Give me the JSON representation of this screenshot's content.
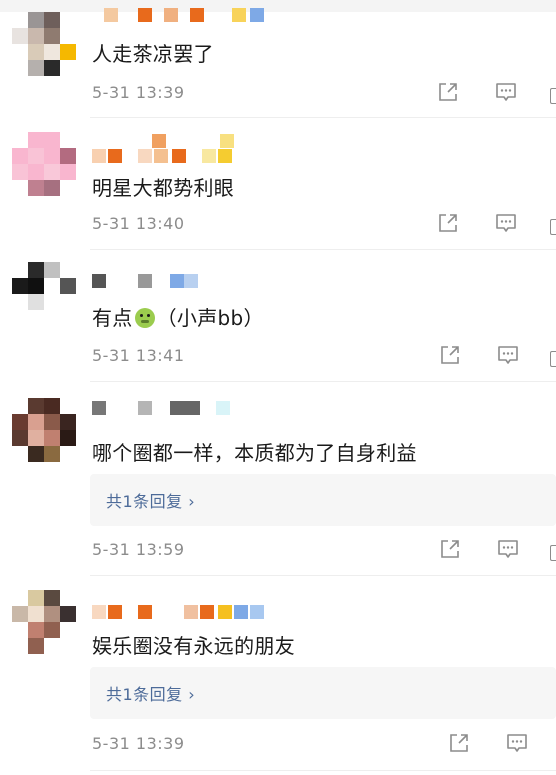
{
  "comments": [
    {
      "content": "人走茶凉罢了",
      "time": "5-31 13:39"
    },
    {
      "content": "明星大都势利眼",
      "time": "5-31 13:40"
    },
    {
      "content_prefix": "有点",
      "emoji": "nauseated-face",
      "content_suffix": "（小声bb）",
      "time": "5-31 13:41"
    },
    {
      "content": "哪个圈都一样，本质都为了自身利益",
      "reply_link": "共1条回复 ›",
      "time": "5-31 13:59"
    },
    {
      "content": "娱乐圈没有永远的朋友",
      "reply_link": "共1条回复 ›",
      "time": "5-31 13:39"
    }
  ],
  "icons": {
    "share": "share-icon",
    "comment": "comment-icon"
  },
  "colors": {
    "link": "#4d6b99",
    "meta_text": "#8c8c8c",
    "reply_bg": "#f6f6f6"
  }
}
